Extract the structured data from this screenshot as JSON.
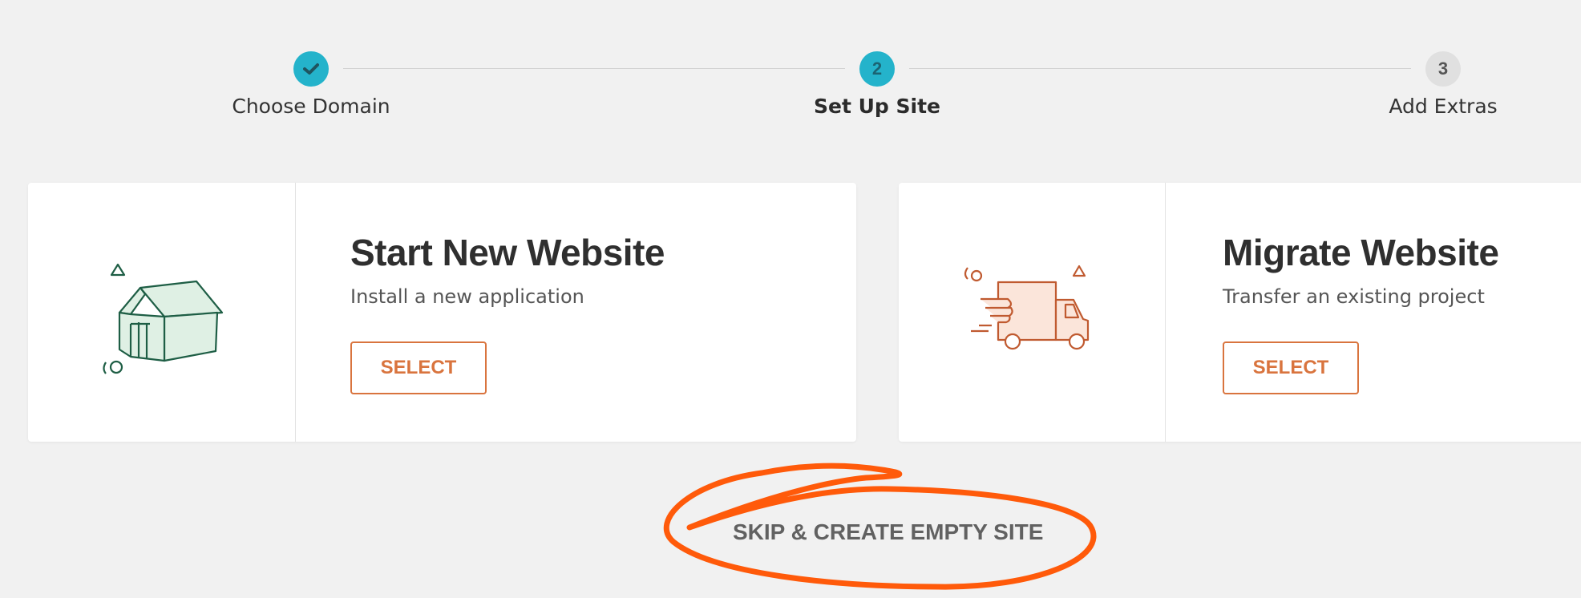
{
  "stepper": {
    "steps": [
      {
        "number": "",
        "label": "Choose Domain",
        "state": "done",
        "icon": "checkmark-icon"
      },
      {
        "number": "2",
        "label": "Set Up Site",
        "state": "active"
      },
      {
        "number": "3",
        "label": "Add Extras",
        "state": "pending"
      }
    ]
  },
  "cards": [
    {
      "title": "Start New Website",
      "description": "Install a new application",
      "button_label": "SELECT",
      "icon": "house-box-illustration"
    },
    {
      "title": "Migrate Website",
      "description": "Transfer an existing project",
      "button_label": "SELECT",
      "icon": "delivery-truck-illustration"
    }
  ],
  "skip": {
    "label": "SKIP & CREATE EMPTY SITE"
  },
  "colors": {
    "accent": "#24b3cb",
    "button": "#d9743e",
    "annotation": "#ff5a0a",
    "house_stroke": "#1e5e45",
    "house_fill": "#dff0e4",
    "truck_stroke": "#c05a30",
    "truck_fill": "#fbe5da"
  }
}
